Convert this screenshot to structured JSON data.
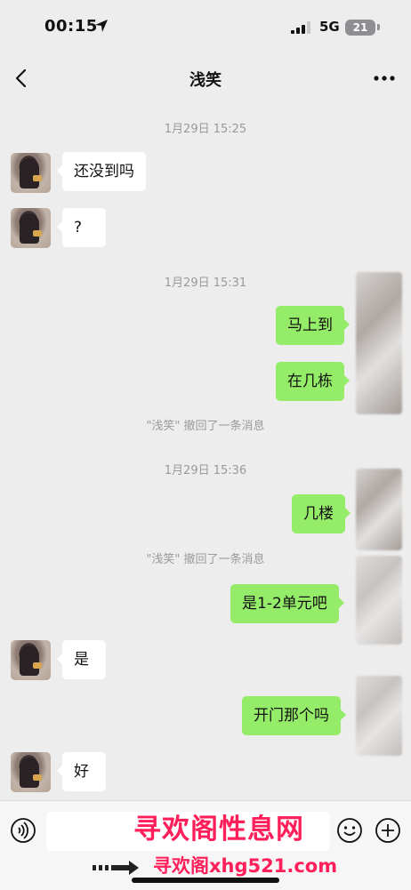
{
  "status": {
    "time": "00:15",
    "network": "5G",
    "battery": "21"
  },
  "nav": {
    "title": "浅笑"
  },
  "timestamps": [
    "1月29日 15:25",
    "1月29日 15:31",
    "1月29日 15:36"
  ],
  "recall_notice": "\"浅笑\" 撤回了一条消息",
  "messages": [
    {
      "side": "in",
      "text": "还没到吗"
    },
    {
      "side": "in",
      "text": "?"
    },
    {
      "side": "out",
      "text": "马上到"
    },
    {
      "side": "out",
      "text": "在几栋"
    },
    {
      "side": "out",
      "text": "几楼"
    },
    {
      "side": "out",
      "text": "是1-2单元吧"
    },
    {
      "side": "in",
      "text": "是"
    },
    {
      "side": "out",
      "text": "开门那个吗"
    },
    {
      "side": "in",
      "text": "好"
    }
  ],
  "watermark": {
    "line1": "寻欢阁性息网",
    "line2": "寻欢阁xhg521.com"
  },
  "icons": {
    "back": "chevron-left-icon",
    "more": "ellipsis-icon",
    "voice": "voice-icon",
    "emoji": "emoji-icon",
    "plus": "plus-circle-icon"
  }
}
